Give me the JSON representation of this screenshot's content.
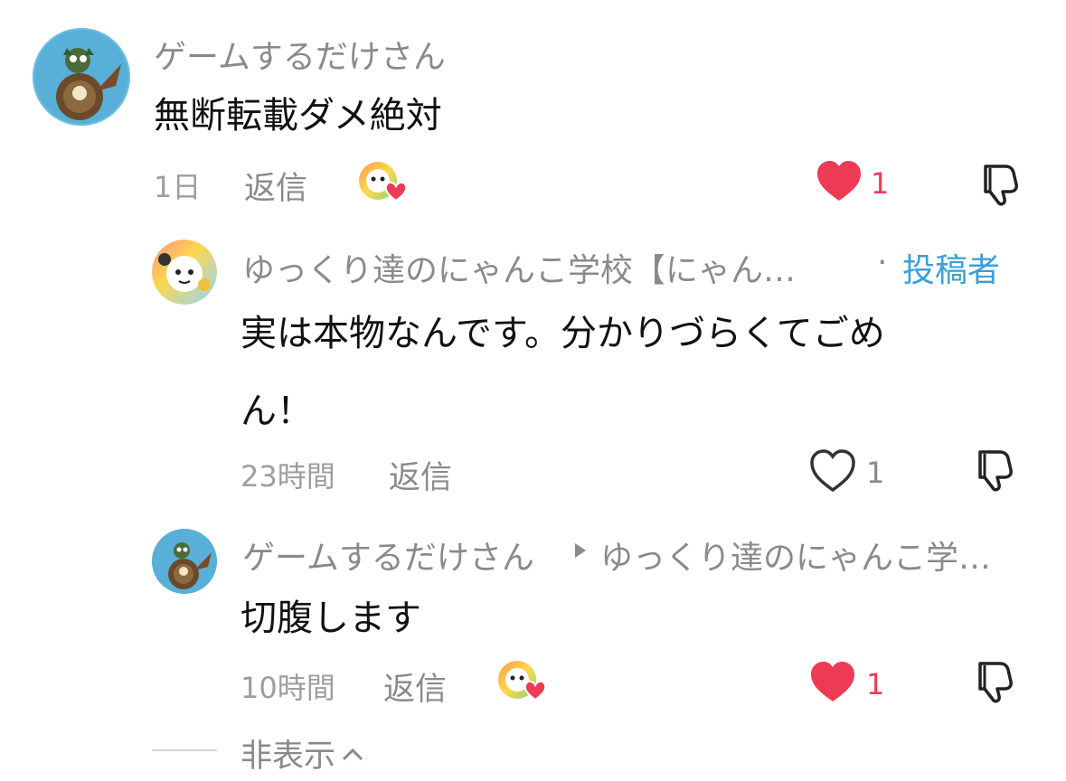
{
  "comment": {
    "username": "ゲームするだけさん",
    "text": "無断転載ダメ絶対",
    "time": "1日",
    "reply_label": "返信",
    "like_count": "1",
    "liked_by_creator": true,
    "liked": true
  },
  "replies": [
    {
      "username": "ゲームするだけさん",
      "username_truncated": "ゆっくり達のにゃんこ学校【にゃん…",
      "separator": "·",
      "creator_badge": "投稿者",
      "text_line1": "実は本物なんです。分かりづらくてごめ",
      "text_line2": "ん！",
      "time": "23時間",
      "reply_label": "返信",
      "like_count": "1",
      "liked": false
    },
    {
      "username": "ゲームするだけさん",
      "reply_to": "ゆっくり達のにゃんこ学…",
      "text": "切腹します",
      "time": "10時間",
      "reply_label": "返信",
      "like_count": "1",
      "liked": true,
      "liked_by_creator": true
    }
  ],
  "collapse_label": "非表示",
  "colors": {
    "heart": "#ee3b55",
    "creator_badge": "#3aa0d6",
    "muted_text": "#8a8a8a"
  }
}
